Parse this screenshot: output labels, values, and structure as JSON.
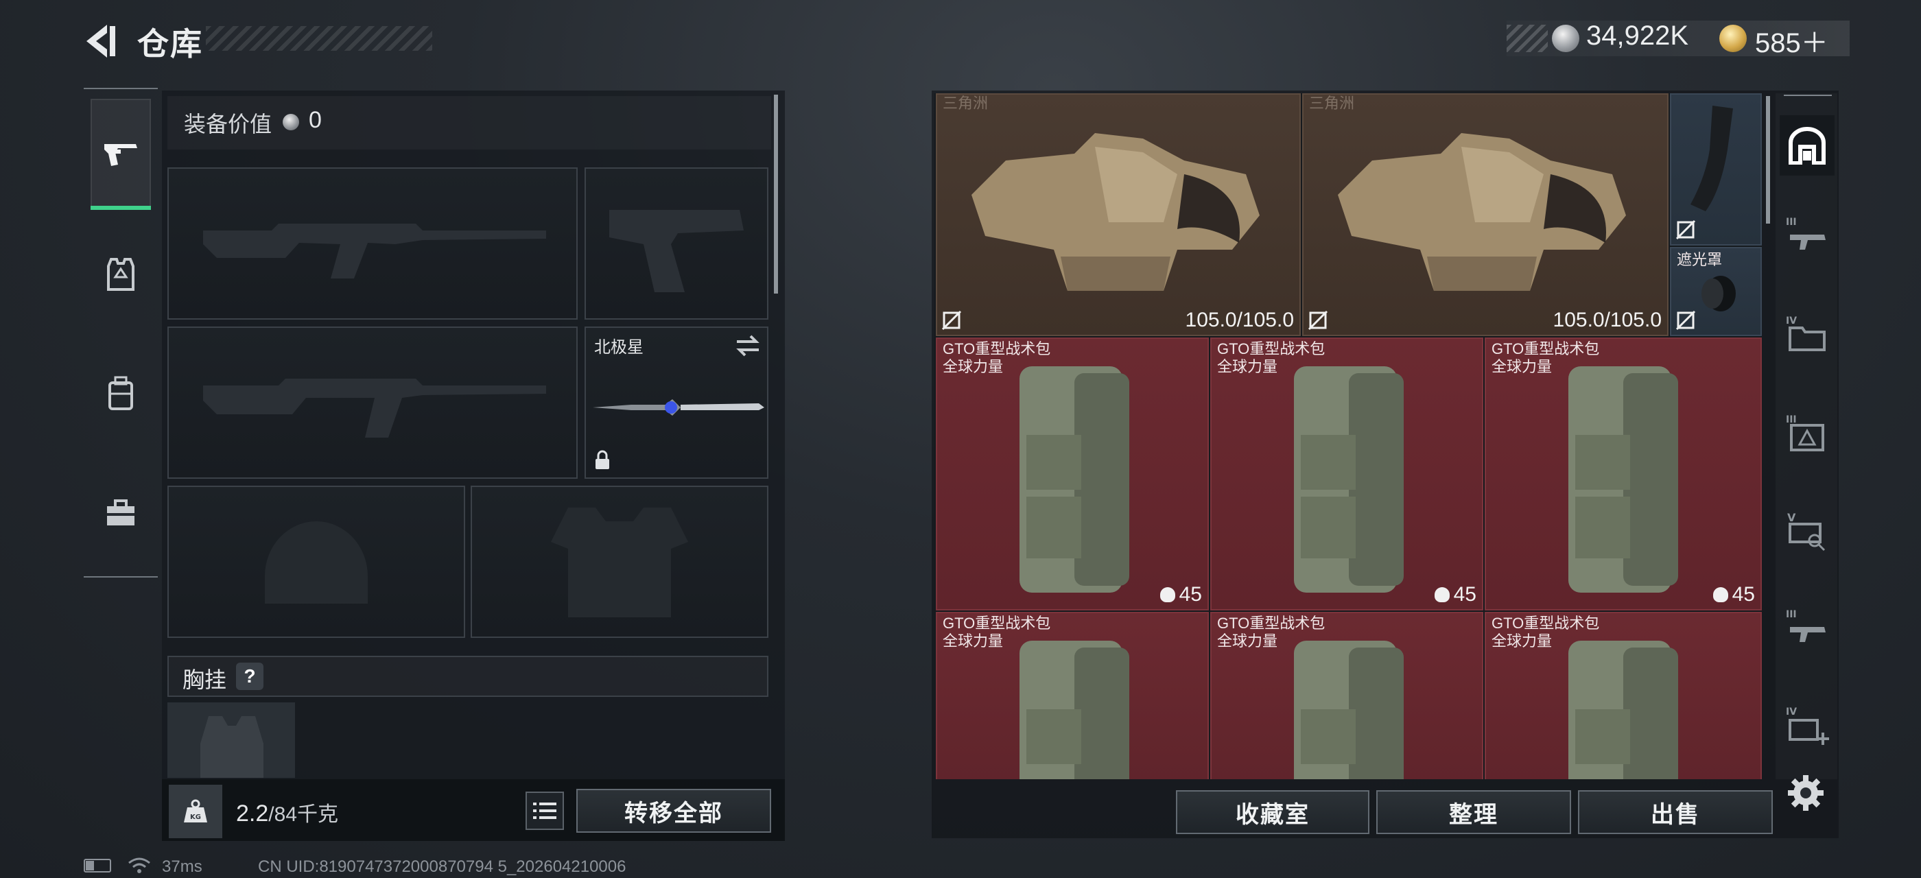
{
  "header": {
    "title": "仓库",
    "currency": {
      "silver": "34,922K",
      "gold": "585＋"
    }
  },
  "left_nav": {
    "items": [
      "weapon",
      "armor",
      "backpack",
      "toolbox"
    ]
  },
  "loadout": {
    "value_label": "装备价值",
    "value_num": "0",
    "melee_name": "北极星",
    "chest_label": "胸挂",
    "help": "?",
    "weight": "2.2",
    "weight_cap": "/84千克",
    "transfer_all": "转移全部"
  },
  "stash": {
    "armor_top_text": "三角洲",
    "armor": [
      {
        "durability": "105.0/105.0"
      },
      {
        "durability": "105.0/105.0"
      }
    ],
    "hood_label": "遮光罩",
    "bags": [
      {
        "line1": "GTO重型战术包",
        "line2": "全球力量",
        "qty": "45"
      },
      {
        "line1": "GTO重型战术包",
        "line2": "全球力量",
        "qty": "45"
      },
      {
        "line1": "GTO重型战术包",
        "line2": "全球力量",
        "qty": "45"
      },
      {
        "line1": "GTO重型战术包",
        "line2": "全球力量"
      },
      {
        "line1": "GTO重型战术包",
        "line2": "全球力量"
      },
      {
        "line1": "GTO重型战术包",
        "line2": "全球力量"
      }
    ],
    "buttons": {
      "collection": "收藏室",
      "organize": "整理",
      "sell": "出售"
    },
    "side_tabs": [
      "all",
      "III",
      "IV",
      "III",
      "V",
      "III",
      "IV+"
    ]
  },
  "status_bar": {
    "ping": "37ms",
    "uid": "CN UID:8190747372000870794 5_202604210006"
  },
  "colors": {
    "accent_green": "#3fd28b",
    "armor_cell": "#4a3b31",
    "bag_cell": "#6b2a31",
    "blue_cell": "#2d3946"
  }
}
